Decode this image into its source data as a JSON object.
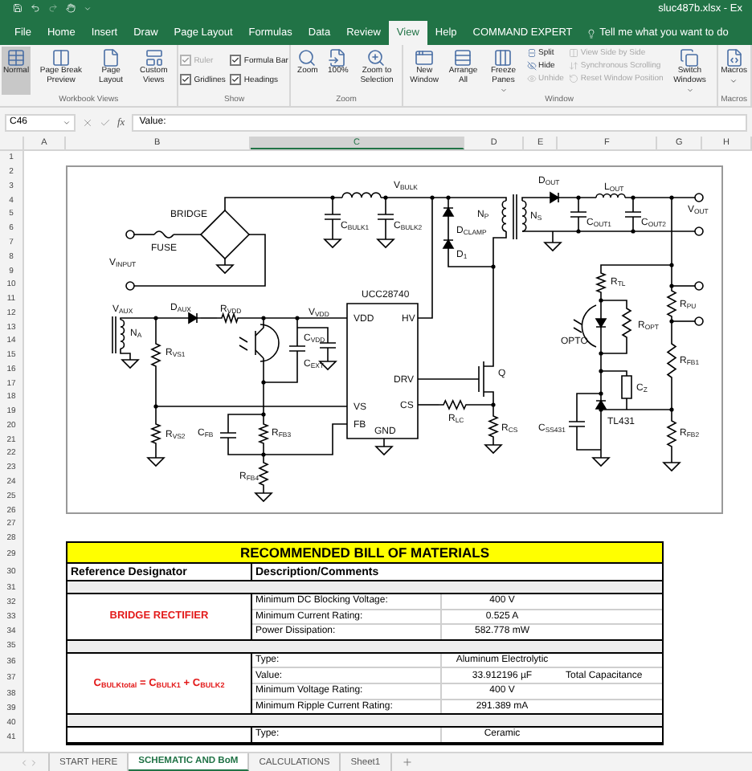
{
  "title_bar": {
    "filename": "sluc487b.xlsx - Ex"
  },
  "ribbon_tabs": [
    {
      "label": "File",
      "selected": false
    },
    {
      "label": "Home",
      "selected": false
    },
    {
      "label": "Insert",
      "selected": false
    },
    {
      "label": "Draw",
      "selected": false
    },
    {
      "label": "Page Layout",
      "selected": false
    },
    {
      "label": "Formulas",
      "selected": false
    },
    {
      "label": "Data",
      "selected": false
    },
    {
      "label": "Review",
      "selected": false
    },
    {
      "label": "View",
      "selected": true
    },
    {
      "label": "Help",
      "selected": false
    },
    {
      "label": "COMMAND EXPERT",
      "selected": false
    }
  ],
  "tell_me": "Tell me what you want to do",
  "ribbon_groups": [
    {
      "label": "Workbook Views",
      "items": [
        {
          "kind": "large",
          "label": "Normal",
          "selected": true,
          "dropdown": false
        },
        {
          "kind": "large",
          "label": "Page Break Preview",
          "selected": false,
          "dropdown": false
        },
        {
          "kind": "large",
          "label": "Page Layout",
          "selected": false,
          "dropdown": false
        },
        {
          "kind": "large",
          "label": "Custom Views",
          "selected": false,
          "dropdown": false
        }
      ]
    },
    {
      "label": "Show",
      "items": [
        {
          "kind": "check",
          "label": "Ruler",
          "checked": true,
          "disabled": true
        },
        {
          "kind": "check",
          "label": "Gridlines",
          "checked": true,
          "disabled": false
        },
        {
          "kind": "check",
          "label": "Formula Bar",
          "checked": true,
          "disabled": false
        },
        {
          "kind": "check",
          "label": "Headings",
          "checked": true,
          "disabled": false
        }
      ]
    },
    {
      "label": "Zoom",
      "items": [
        {
          "kind": "large",
          "label": "Zoom",
          "dropdown": false
        },
        {
          "kind": "large",
          "label": "100%",
          "dropdown": false
        },
        {
          "kind": "large",
          "label": "Zoom to Selection",
          "dropdown": false
        }
      ]
    },
    {
      "label": "Window",
      "items": [
        {
          "kind": "large",
          "label": "New Window",
          "dropdown": false
        },
        {
          "kind": "large",
          "label": "Arrange All",
          "dropdown": false
        },
        {
          "kind": "large",
          "label": "Freeze Panes",
          "dropdown": true
        },
        {
          "kind": "small",
          "label": "Split",
          "disabled": false
        },
        {
          "kind": "small",
          "label": "Hide",
          "disabled": false
        },
        {
          "kind": "small",
          "label": "Unhide",
          "disabled": true
        },
        {
          "kind": "small",
          "label": "View Side by Side",
          "disabled": true
        },
        {
          "kind": "small",
          "label": "Synchronous Scrolling",
          "disabled": true
        },
        {
          "kind": "small",
          "label": "Reset Window Position",
          "disabled": true
        },
        {
          "kind": "large",
          "label": "Switch Windows",
          "dropdown": true
        }
      ]
    },
    {
      "label": "Macros",
      "items": [
        {
          "kind": "large",
          "label": "Macros",
          "dropdown": true
        }
      ]
    }
  ],
  "formula_bar": {
    "name_box": "C46",
    "function_label": "fx",
    "formula": "Value:"
  },
  "columns": [
    {
      "label": "A",
      "selected": false
    },
    {
      "label": "B",
      "selected": false
    },
    {
      "label": "C",
      "selected": true
    },
    {
      "label": "D",
      "selected": false
    },
    {
      "label": "E",
      "selected": false
    },
    {
      "label": "F",
      "selected": false
    },
    {
      "label": "G",
      "selected": false
    },
    {
      "label": "H",
      "selected": false
    }
  ],
  "row_numbers": [
    "1",
    "2",
    "3",
    "4",
    "5",
    "6",
    "7",
    "8",
    "9",
    "10",
    "11",
    "12",
    "13",
    "14",
    "15",
    "16",
    "17",
    "18",
    "19",
    "20",
    "21",
    "22",
    "23",
    "24",
    "25",
    "26",
    "27",
    "28",
    "29",
    "30",
    "31",
    "32",
    "33",
    "34",
    "35",
    "36",
    "37",
    "38",
    "39",
    "40",
    "41"
  ],
  "schematic": {
    "labels": [
      "BRIDGE",
      "FUSE",
      "V$_{INPUT}$",
      "V$_{BULK}$",
      "C$_{BULK1}$",
      "C$_{BULK2}$",
      "D$_{CLAMP}$",
      "D$_{1}$",
      "N$_{P}$",
      "N$_{S}$",
      "D$_{OUT}$",
      "L$_{OUT}$",
      "C$_{OUT1}$",
      "C$_{OUT2}$",
      "V$_{OUT}$",
      "UCC28740",
      "V$_{AUX}$",
      "N$_{A}$",
      "D$_{AUX}$",
      "R$_{VDD}$",
      "V$_{VDD}$",
      "C$_{VDD}$",
      "C$_{EXT}$",
      "R$_{VS1}$",
      "R$_{VS2}$",
      "VDD",
      "HV",
      "DRV",
      "CS",
      "VS",
      "FB",
      "C$_{FB}$",
      "R$_{FB3}$",
      "GND",
      "R$_{FB4}$",
      "R$_{LC}$",
      "R$_{CS}$",
      "Q",
      "R$_{TL}$",
      "R$_{OPT}$",
      "OPTO",
      "R$_{PU}$",
      "R$_{FB1}$",
      "R$_{FB2}$",
      "C$_{Z}$",
      "C$_{SS431}$",
      "TL431"
    ]
  },
  "bom": {
    "title": "RECOMMENDED BILL OF MATERIALS",
    "headers": [
      "Reference Designator",
      "Description/Comments"
    ],
    "sections": [
      {
        "designator": "BRIDGE RECTIFIER",
        "rows": [
          {
            "label": "Minimum DC Blocking Voltage:",
            "value": "400 V"
          },
          {
            "label": "Minimum Current Rating:",
            "value": "0.525 A"
          },
          {
            "label": "Power Dissipation:",
            "value": "582.778 mW"
          }
        ]
      },
      {
        "designator": "C$_{BULKtotal}$ = C$_{BULK1}$ + C$_{BULK2}$",
        "rows": [
          {
            "label": "Type:",
            "value": "Aluminum Electrolytic"
          },
          {
            "label": "Value:",
            "value": "33.912196 µF",
            "note": "Total Capacitance"
          },
          {
            "label": "Minimum Voltage Rating:",
            "value": "400 V"
          },
          {
            "label": "Minimum Ripple Current Rating:",
            "value": "291.389 mA"
          }
        ]
      },
      {
        "rows": [
          {
            "label": "Type:",
            "value": "Ceramic"
          }
        ]
      }
    ]
  },
  "sheet_tabs": [
    {
      "label": "START HERE",
      "selected": false
    },
    {
      "label": "SCHEMATIC AND BoM",
      "selected": true
    },
    {
      "label": "CALCULATIONS",
      "selected": false
    },
    {
      "label": "Sheet1",
      "selected": false
    }
  ]
}
